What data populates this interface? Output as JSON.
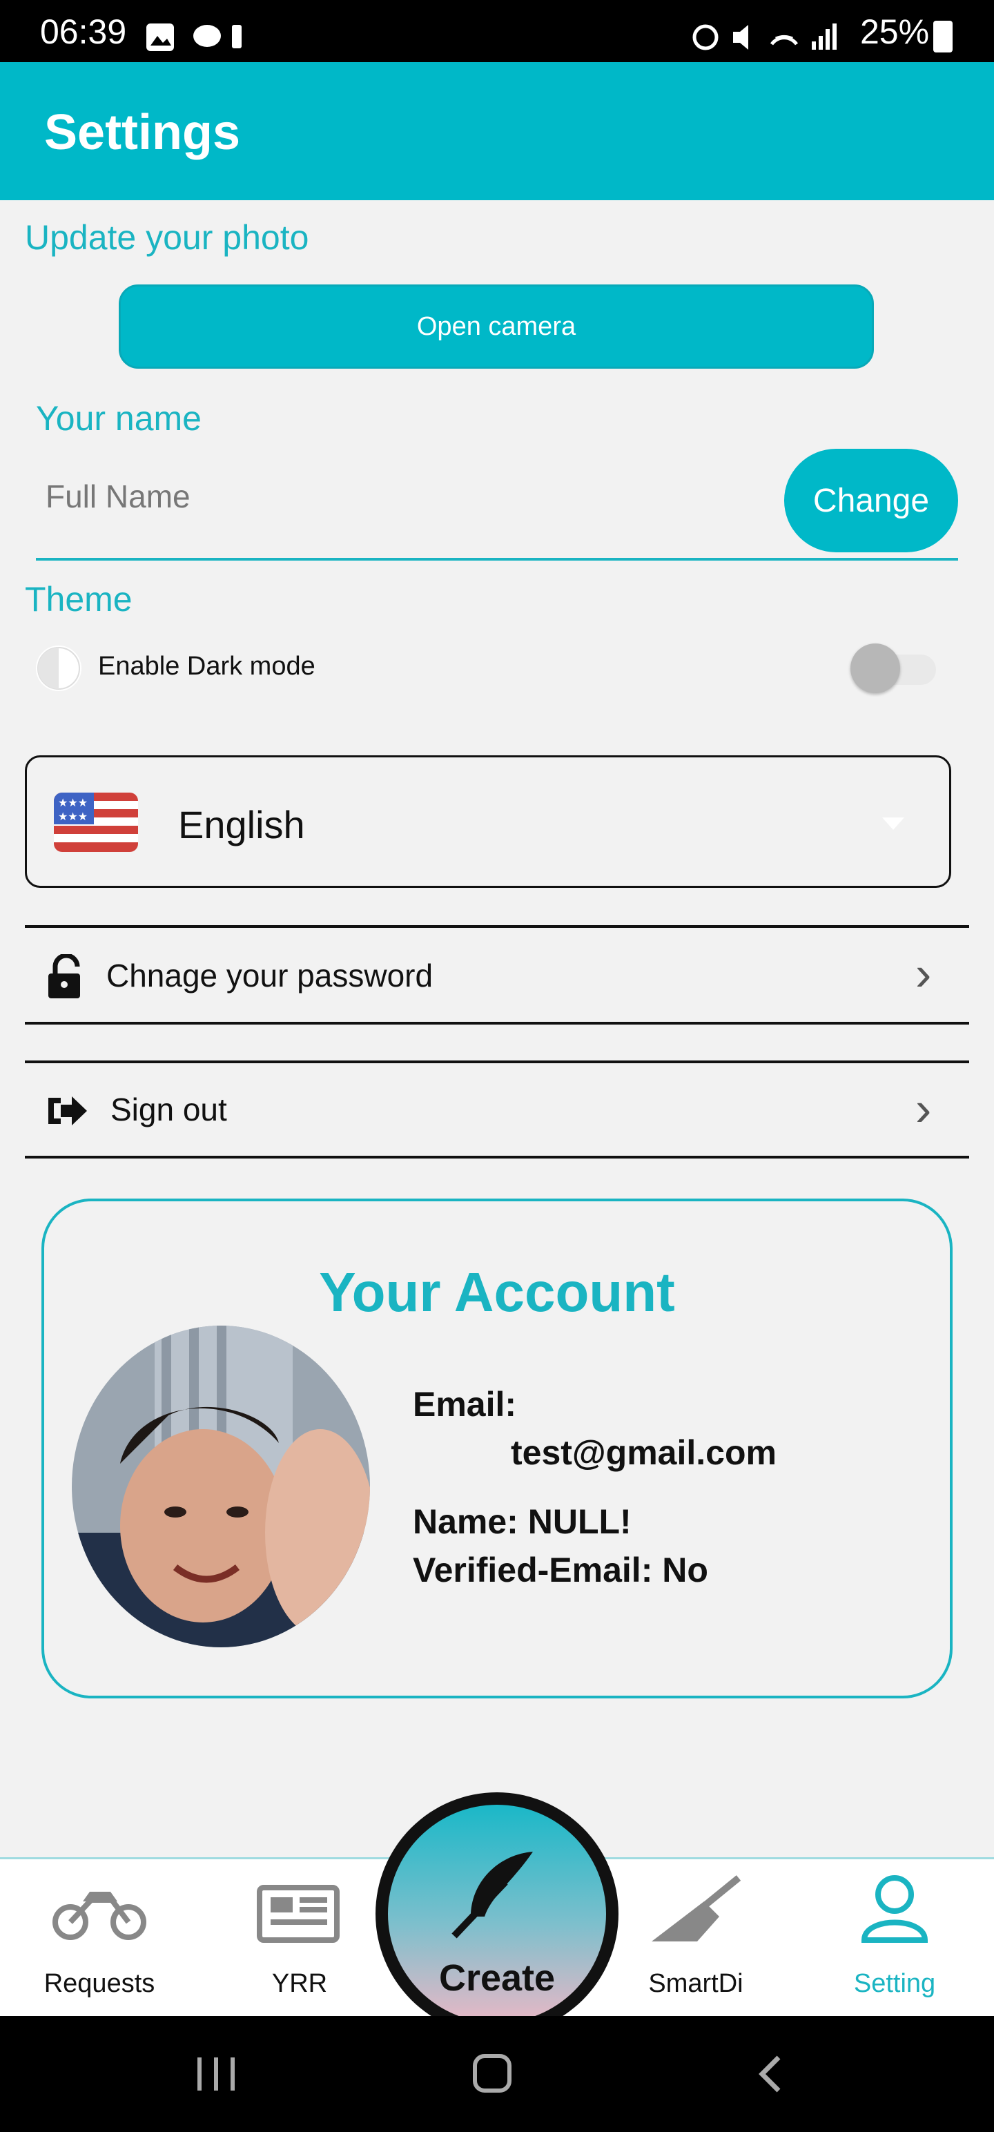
{
  "status_bar": {
    "time": "06:39",
    "battery": "25%"
  },
  "header": {
    "title": "Settings"
  },
  "photo": {
    "label": "Update your photo",
    "button": "Open camera"
  },
  "name": {
    "label": "Your name",
    "placeholder": "Full Name",
    "button": "Change"
  },
  "theme": {
    "label": "Theme",
    "dark_mode_label": "Enable Dark mode",
    "dark_mode_enabled": false
  },
  "language": {
    "selected": "English"
  },
  "menu": [
    {
      "label": "Chnage your password"
    },
    {
      "label": "Sign out"
    }
  ],
  "account": {
    "title": "Your Account",
    "email_label": "Email:",
    "email_value": "test@gmail.com",
    "name_line": "Name: NULL!",
    "verified_line": "Verified-Email: No"
  },
  "bottom_nav": [
    {
      "label": "Requests",
      "icon": "motorcycle-icon"
    },
    {
      "label": "YRR",
      "icon": "newspaper-icon"
    },
    {
      "label": "Create",
      "icon": "feather-icon"
    },
    {
      "label": "SmartDi",
      "icon": "broom-icon"
    },
    {
      "label": "Setting",
      "icon": "user-icon",
      "active": true
    }
  ],
  "colors": {
    "accent": "#00b8c8",
    "text": "#111111",
    "background": "#f2f2f2"
  }
}
